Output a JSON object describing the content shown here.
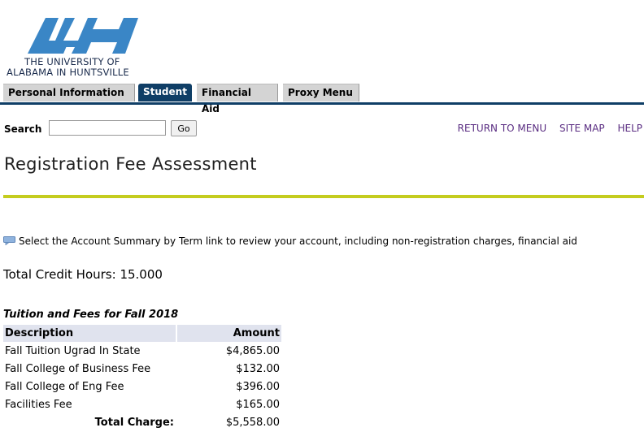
{
  "header": {
    "logo_line1": "THE UNIVERSITY OF",
    "logo_line2": "ALABAMA IN HUNTSVILLE",
    "logo_color": "#3a86c6"
  },
  "tabs": [
    {
      "label": "Personal Information",
      "active": false
    },
    {
      "label": "Student",
      "active": true
    },
    {
      "label": "Financial Aid",
      "active": false
    },
    {
      "label": "Proxy Menu",
      "active": false
    }
  ],
  "search": {
    "label": "Search",
    "value": "",
    "button": "Go"
  },
  "links": {
    "return": "RETURN TO MENU",
    "sitemap": "SITE MAP",
    "help": "HELP"
  },
  "page_title": "Registration Fee Assessment",
  "info_text": "Select the Account Summary by Term link to review your account, including non-registration charges, financial aid",
  "credit_hours": "Total Credit Hours: 15.000",
  "fees": {
    "caption": "Tuition and Fees for Fall 2018",
    "col_description": "Description",
    "col_amount": "Amount",
    "rows": [
      {
        "description": "Fall Tuition Ugrad In State",
        "amount": "$4,865.00"
      },
      {
        "description": "Fall College of Business Fee",
        "amount": "$132.00"
      },
      {
        "description": "Fall College of Eng Fee",
        "amount": "$396.00"
      },
      {
        "description": "Facilities Fee",
        "amount": "$165.00"
      }
    ],
    "total_label": "Total Charge:",
    "total_amount": "$5,558.00"
  },
  "colors": {
    "navy": "#0f3e66",
    "accent_rule": "#c4cc1e",
    "link": "#5a2d82"
  }
}
